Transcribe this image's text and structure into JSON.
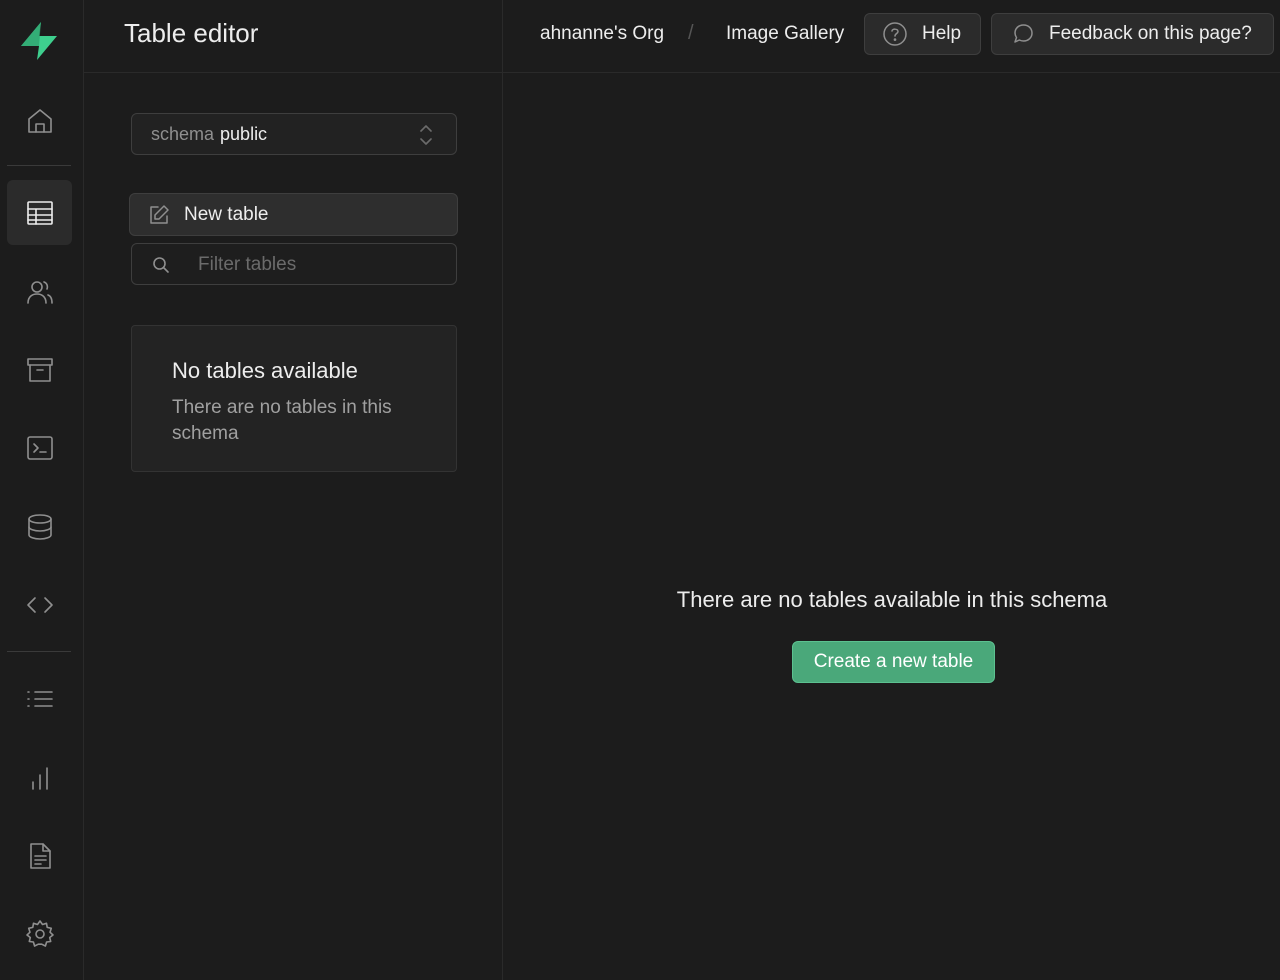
{
  "app": {
    "accent": "#3ecf8e",
    "button_green": "#4aa87a"
  },
  "header": {
    "title": "Table editor",
    "breadcrumb_org": "ahnanne's Org",
    "breadcrumb_separator": "/",
    "breadcrumb_project": "Image Gallery",
    "help_label": "Help",
    "feedback_label": "Feedback on this page?"
  },
  "rail": {
    "items": [
      {
        "icon": "home-icon"
      },
      {
        "icon": "table-icon",
        "active": true
      },
      {
        "icon": "users-icon"
      },
      {
        "icon": "archive-icon"
      },
      {
        "icon": "terminal-icon"
      },
      {
        "icon": "database-icon"
      },
      {
        "icon": "code-icon"
      },
      {
        "icon": "list-icon"
      },
      {
        "icon": "bar-chart-icon"
      },
      {
        "icon": "document-icon"
      },
      {
        "icon": "gear-icon"
      }
    ]
  },
  "sidebar": {
    "schema_prefix": "schema",
    "schema_value": "public",
    "new_table_label": "New table",
    "filter_placeholder": "Filter tables",
    "filter_value": "",
    "empty_title": "No tables available",
    "empty_description": "There are no tables in this schema"
  },
  "main": {
    "empty_message": "There are no tables available in this schema",
    "create_button_label": "Create a new table"
  }
}
